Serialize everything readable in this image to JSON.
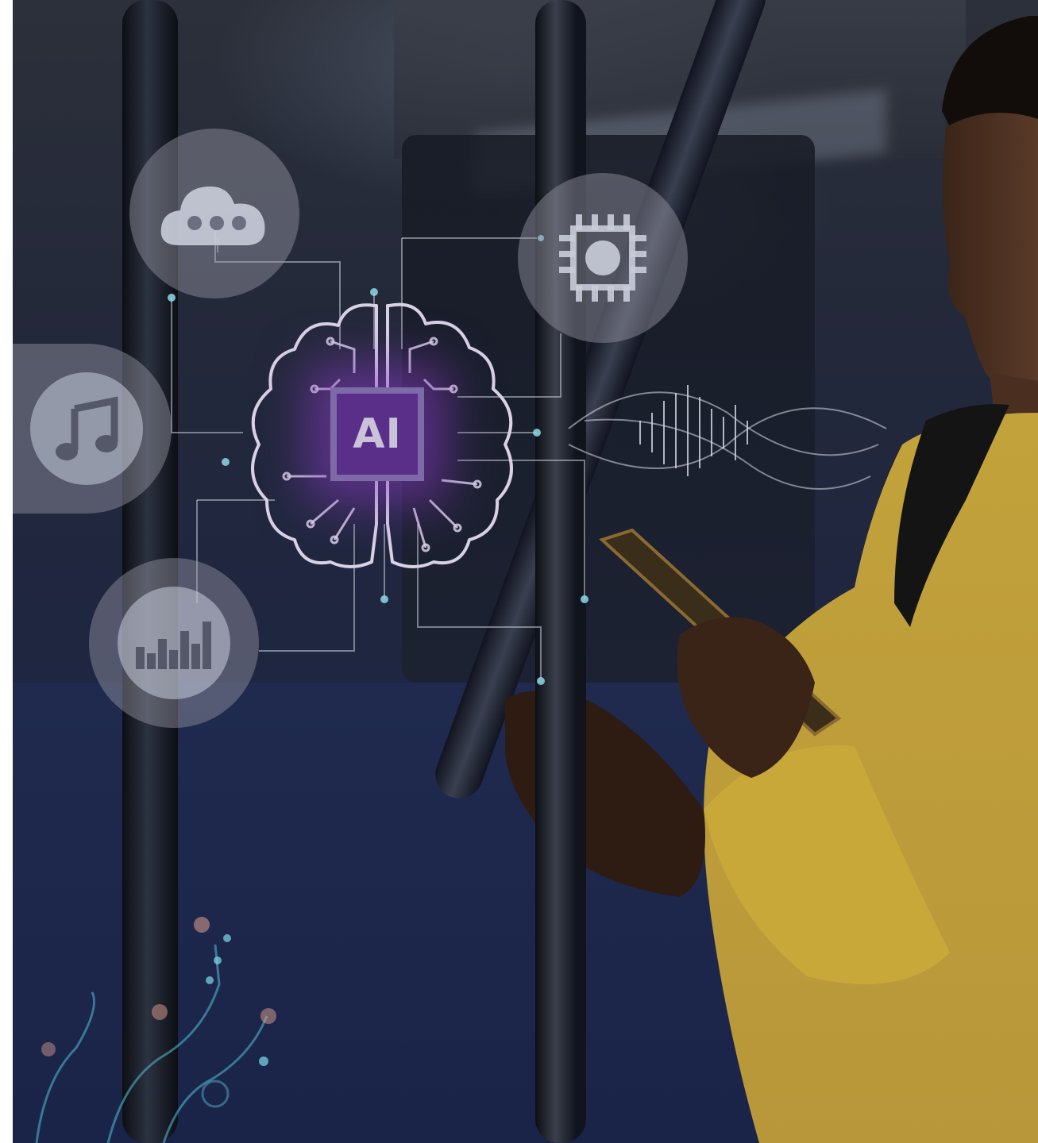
{
  "scene": {
    "chip_label": "AI",
    "icons": [
      {
        "name": "cloud-chat-icon"
      },
      {
        "name": "processor-chip-icon"
      },
      {
        "name": "music-note-icon"
      },
      {
        "name": "equalizer-icon"
      }
    ],
    "colors": {
      "glow": "#8c3cc8",
      "chip": "#5a2f8a",
      "sweater": "#c9a83a",
      "overlay": "#1c2444"
    }
  }
}
